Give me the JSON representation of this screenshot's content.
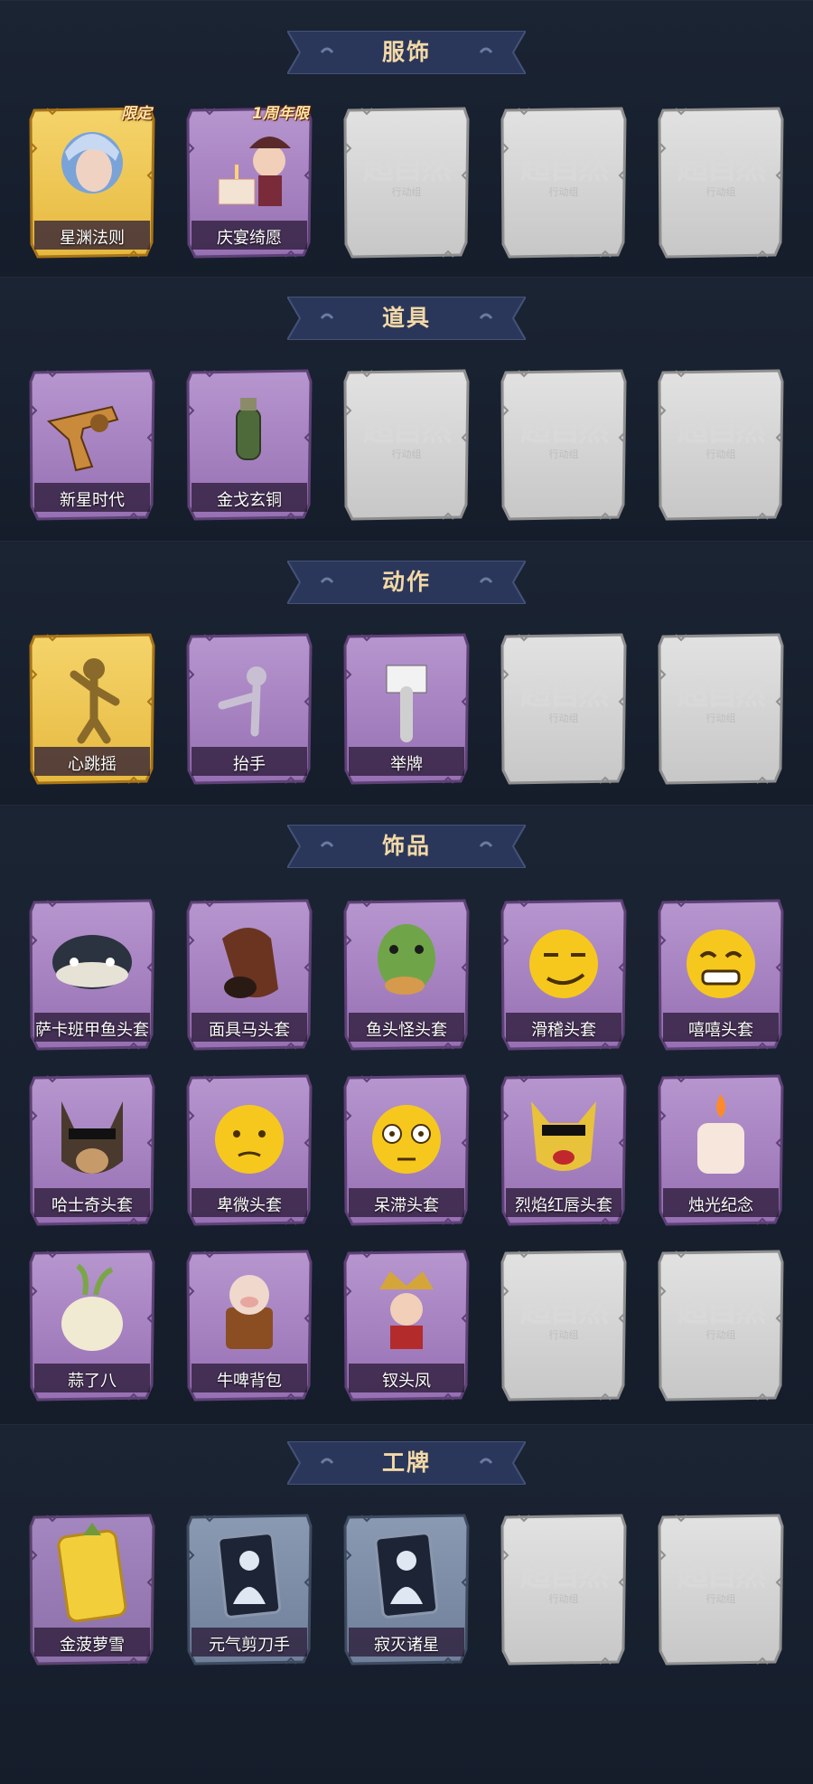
{
  "sections": [
    {
      "title": "服饰",
      "items": [
        {
          "label": "星渊法则",
          "rarity": "gold",
          "badge": "限定",
          "icon": "character-portrait-icon"
        },
        {
          "label": "庆宴绮愿",
          "rarity": "purple",
          "badge": "1周年限",
          "icon": "cake-character-icon"
        },
        {
          "label": "",
          "rarity": "empty"
        },
        {
          "label": "",
          "rarity": "empty"
        },
        {
          "label": "",
          "rarity": "empty"
        }
      ]
    },
    {
      "title": "道具",
      "items": [
        {
          "label": "新星时代",
          "rarity": "purple",
          "icon": "revolver-icon"
        },
        {
          "label": "金戈玄铜",
          "rarity": "purple",
          "icon": "grenade-icon"
        },
        {
          "label": "",
          "rarity": "empty"
        },
        {
          "label": "",
          "rarity": "empty"
        },
        {
          "label": "",
          "rarity": "empty"
        }
      ]
    },
    {
      "title": "动作",
      "items": [
        {
          "label": "心跳摇",
          "rarity": "gold",
          "icon": "dance-pose-icon"
        },
        {
          "label": "抬手",
          "rarity": "purple",
          "icon": "raise-hand-pose-icon"
        },
        {
          "label": "举牌",
          "rarity": "purple",
          "icon": "hold-sign-pose-icon"
        },
        {
          "label": "",
          "rarity": "empty"
        },
        {
          "label": "",
          "rarity": "empty"
        }
      ]
    },
    {
      "title": "饰品",
      "items": [
        {
          "label": "萨卡班甲鱼头套",
          "rarity": "purple",
          "icon": "fish-head-icon"
        },
        {
          "label": "面具马头套",
          "rarity": "purple",
          "icon": "horse-head-icon"
        },
        {
          "label": "鱼头怪头套",
          "rarity": "purple",
          "icon": "green-fish-head-icon"
        },
        {
          "label": "滑稽头套",
          "rarity": "purple",
          "icon": "smirk-emoji-icon"
        },
        {
          "label": "嘻嘻头套",
          "rarity": "purple",
          "icon": "grin-emoji-icon"
        },
        {
          "label": "哈士奇头套",
          "rarity": "purple",
          "icon": "husky-head-icon"
        },
        {
          "label": "卑微头套",
          "rarity": "purple",
          "icon": "humble-emoji-icon"
        },
        {
          "label": "呆滞头套",
          "rarity": "purple",
          "icon": "dazed-emoji-icon"
        },
        {
          "label": "烈焰红唇头套",
          "rarity": "purple",
          "icon": "yellow-mask-icon"
        },
        {
          "label": "烛光纪念",
          "rarity": "purple",
          "icon": "candle-icon"
        },
        {
          "label": "蒜了八",
          "rarity": "purple",
          "icon": "garlic-icon"
        },
        {
          "label": "牛啤背包",
          "rarity": "purple",
          "icon": "cow-beer-icon"
        },
        {
          "label": "钗头凤",
          "rarity": "purple",
          "icon": "phoenix-crown-icon"
        },
        {
          "label": "",
          "rarity": "empty"
        },
        {
          "label": "",
          "rarity": "empty"
        }
      ]
    },
    {
      "title": "工牌",
      "items": [
        {
          "label": "金菠萝雪",
          "rarity": "gold-card",
          "icon": "pineapple-card-icon"
        },
        {
          "label": "元气剪刀手",
          "rarity": "blue",
          "icon": "victory-pose-card-icon"
        },
        {
          "label": "寂灭诸星",
          "rarity": "blue",
          "icon": "silhouette-card-icon"
        },
        {
          "label": "",
          "rarity": "empty"
        },
        {
          "label": "",
          "rarity": "empty"
        }
      ]
    }
  ],
  "placeholder": {
    "title": "超自然",
    "subtitle": "行动组"
  },
  "colors": {
    "background": "#0f1624",
    "banner": "#2e3a5e",
    "banner_text": "#f3d9a6",
    "gold": "#d9a832",
    "purple": "#8a62a6",
    "blue": "#5a6d8a",
    "empty": "#b5b5b5"
  }
}
